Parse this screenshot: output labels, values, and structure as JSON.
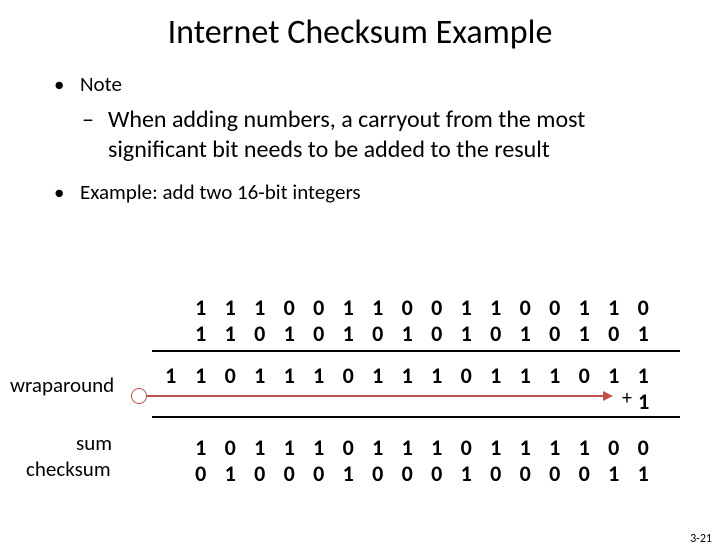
{
  "title": "Internet Checksum Example",
  "bullets": {
    "note_label": "Note",
    "note_sub": "When adding numbers, a carryout from the most significant bit needs to be added to the result",
    "example_label": "Example: add two 16-bit integers"
  },
  "bits": {
    "row1": [
      "1",
      "1",
      "1",
      "0",
      "0",
      "1",
      "1",
      "0",
      "0",
      "1",
      "1",
      "0",
      "0",
      "1",
      "1",
      "0"
    ],
    "row2": [
      "1",
      "1",
      "0",
      "1",
      "0",
      "1",
      "0",
      "1",
      "0",
      "1",
      "0",
      "1",
      "0",
      "1",
      "0",
      "1"
    ],
    "row3_carry": "1",
    "row3": [
      "1",
      "0",
      "1",
      "1",
      "1",
      "0",
      "1",
      "1",
      "1",
      "0",
      "1",
      "1",
      "1",
      "0",
      "1",
      "1"
    ],
    "row3_add": "1",
    "sum": [
      "1",
      "0",
      "1",
      "1",
      "1",
      "0",
      "1",
      "1",
      "1",
      "0",
      "1",
      "1",
      "1",
      "1",
      "0",
      "0"
    ],
    "checksum": [
      "0",
      "1",
      "0",
      "0",
      "0",
      "1",
      "0",
      "0",
      "0",
      "1",
      "0",
      "0",
      "0",
      "0",
      "1",
      "1"
    ]
  },
  "labels": {
    "wraparound": "wraparound",
    "sum": "sum",
    "checksum": "checksum",
    "plus": "+"
  },
  "page_num": "3-21"
}
